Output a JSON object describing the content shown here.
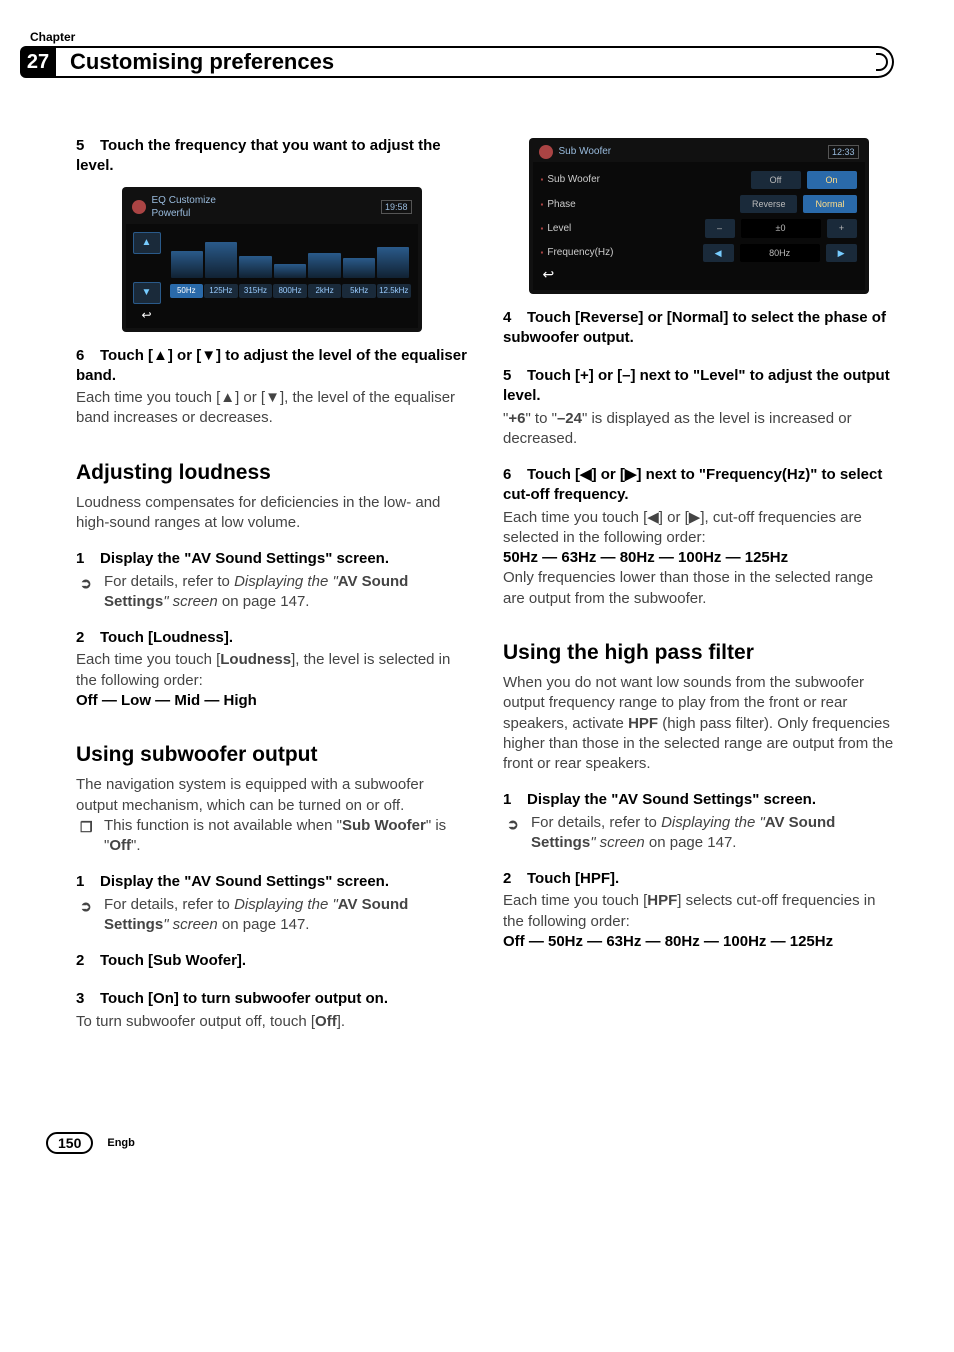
{
  "chapter_label": "Chapter",
  "chapter_number": "27",
  "page_title": "Customising preferences",
  "footer": {
    "page_number": "150",
    "lang": "Engb"
  },
  "eq_screenshot": {
    "title_line1": "EQ Customize",
    "title_line2": "Powerful",
    "time": "19:58",
    "up": "▲",
    "down": "▼",
    "back": "↩",
    "freqs": [
      "50Hz",
      "125Hz",
      "315Hz",
      "800Hz",
      "2kHz",
      "5kHz",
      "12.5kHz"
    ]
  },
  "sw_screenshot": {
    "title": "Sub Woofer",
    "time": "12:33",
    "rows": {
      "subwoofer": {
        "label": "Sub Woofer",
        "left": "Off",
        "right": "On"
      },
      "phase": {
        "label": "Phase",
        "left": "Reverse",
        "right": "Normal"
      },
      "level": {
        "label": "Level",
        "minus": "–",
        "val": "±0",
        "plus": "+"
      },
      "freq": {
        "label": "Frequency(Hz)",
        "left": "◀",
        "val": "80Hz",
        "right": "▶"
      }
    },
    "back": "↩"
  },
  "left": {
    "s5": {
      "num": "5",
      "head": "Touch the frequency that you want to adjust the level."
    },
    "s6": {
      "num": "6",
      "head": "Touch [▲] or [▼] to adjust the level of the equaliser band.",
      "body": "Each time you touch [▲] or [▼], the level of the equaliser band increases or decreases."
    },
    "loudness": {
      "title": "Adjusting loudness",
      "intro": "Loudness compensates for deficiencies in the low- and high-sound ranges at low volume.",
      "s1": {
        "num": "1",
        "head": "Display the \"AV Sound Settings\" screen.",
        "ref_pre": "For details, refer to ",
        "ref_i": "Displaying the \"",
        "ref_b": "AV Sound Settings",
        "ref_i2": "\" screen",
        "ref_post": " on page 147."
      },
      "s2": {
        "num": "2",
        "head": "Touch [Loudness].",
        "body_pre": "Each time you touch [",
        "body_b": "Loudness",
        "body_post": "], the level is selected in the following order:",
        "line": "Off — Low — Mid — High"
      }
    },
    "sub": {
      "title": "Using subwoofer output",
      "intro": "The navigation system is equipped with a subwoofer output mechanism, which can be turned on or off.",
      "note_pre": "This function is not available when \"",
      "note_b": "Sub Woofer",
      "note_mid": "\" is \"",
      "note_b2": "Off",
      "note_post": "\".",
      "s1": {
        "num": "1",
        "head": "Display the \"AV Sound Settings\" screen.",
        "ref_pre": "For details, refer to ",
        "ref_i": "Displaying the \"",
        "ref_b": "AV Sound Settings",
        "ref_i2": "\" screen",
        "ref_post": " on page 147."
      },
      "s2": {
        "num": "2",
        "head": "Touch [Sub Woofer]."
      },
      "s3": {
        "num": "3",
        "head": "Touch [On] to turn subwoofer output on.",
        "body_pre": "To turn subwoofer output off, touch [",
        "body_b": "Off",
        "body_post": "]."
      }
    }
  },
  "right": {
    "s4": {
      "num": "4",
      "head": "Touch [Reverse] or [Normal] to select the phase of subwoofer output."
    },
    "s5": {
      "num": "5",
      "head": "Touch [+] or [–] next to \"Level\" to adjust the output level.",
      "body_pre": "\"",
      "body_b": "+6",
      "body_mid": "\" to \"",
      "body_b2": "–24",
      "body_post": "\" is displayed as the level is increased or decreased."
    },
    "s6": {
      "num": "6",
      "head": "Touch [◀] or [▶] next to \"Frequency(Hz)\" to select cut-off frequency.",
      "body": "Each time you touch [◀] or [▶], cut-off frequencies are selected in the following order:",
      "line": "50Hz — 63Hz — 80Hz — 100Hz — 125Hz",
      "body2": "Only frequencies lower than those in the selected range are output from the subwoofer."
    },
    "hpf": {
      "title": "Using the high pass filter",
      "intro_pre": "When you do not want low sounds from the subwoofer output frequency range to play from the front or rear speakers, activate ",
      "intro_b": "HPF",
      "intro_post": " (high pass filter). Only frequencies higher than those in the selected range are output from the front or rear speakers.",
      "s1": {
        "num": "1",
        "head": "Display the \"AV Sound Settings\" screen.",
        "ref_pre": "For details, refer to ",
        "ref_i": "Displaying the \"",
        "ref_b": "AV Sound Settings",
        "ref_i2": "\" screen",
        "ref_post": " on page 147."
      },
      "s2": {
        "num": "2",
        "head": "Touch [HPF].",
        "body_pre": "Each time you touch [",
        "body_b": "HPF",
        "body_post": "] selects cut-off frequencies in the following order:",
        "line": "Off — 50Hz — 63Hz — 80Hz — 100Hz — 125Hz"
      }
    }
  }
}
